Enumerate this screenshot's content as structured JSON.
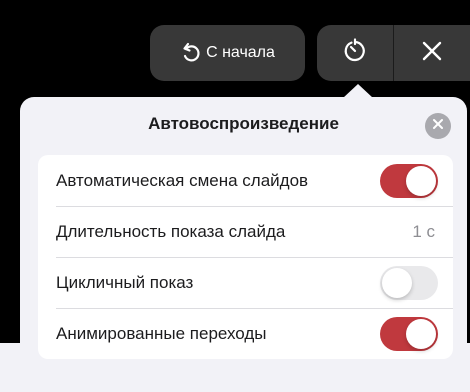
{
  "toolbar": {
    "restart_label": "С начала",
    "restart_icon": "restart-arrow-icon",
    "timer_icon": "timer-icon",
    "close_icon": "close-icon"
  },
  "popover": {
    "title": "Автовоспроизведение",
    "close_icon": "close-circle-icon",
    "rows": [
      {
        "label": "Автоматическая смена слайдов",
        "toggle": true
      },
      {
        "label": "Длительность показа слайда",
        "value": "1 с"
      },
      {
        "label": "Цикличный показ",
        "toggle": false
      },
      {
        "label": "Анимированные переходы",
        "toggle": true
      }
    ]
  },
  "colors": {
    "toggle_on": "#c0393e",
    "toggle_off": "#e9e9eb",
    "button_bg": "#383838",
    "popover_bg": "#f2f2f7"
  }
}
